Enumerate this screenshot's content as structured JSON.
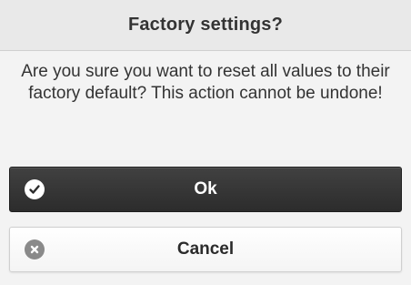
{
  "dialog": {
    "title": "Factory settings?",
    "message": "Are you sure you want to reset all values to their factory default? This action cannot be undone!"
  },
  "buttons": {
    "ok": {
      "label": "Ok",
      "icon": "check-icon"
    },
    "cancel": {
      "label": "Cancel",
      "icon": "close-icon"
    }
  },
  "colors": {
    "ok_background": "#363636",
    "cancel_background": "#f7f7f7",
    "title_background": "#e9e9e9",
    "text": "#333333"
  }
}
